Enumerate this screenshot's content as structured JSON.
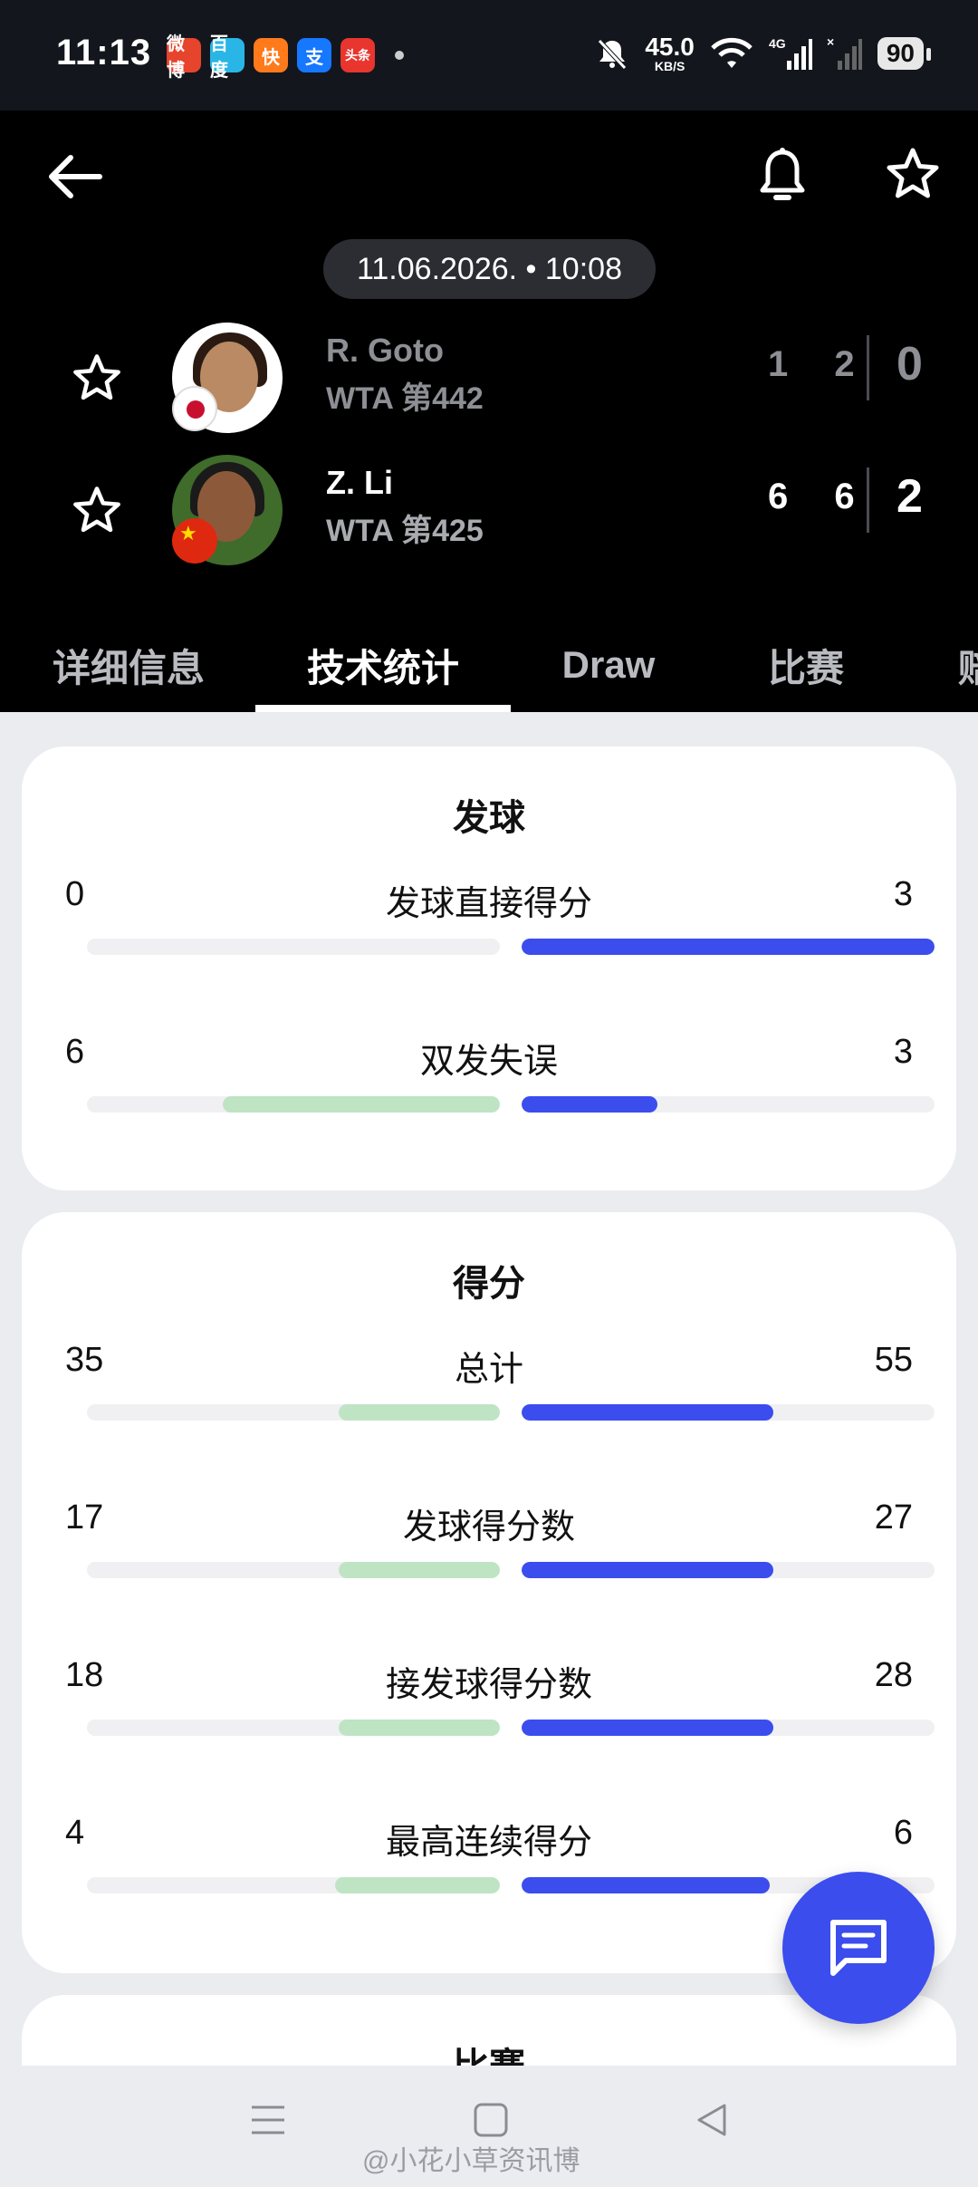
{
  "status_bar": {
    "time": "11:13",
    "net_speed": "45.0",
    "net_unit": "KB/S",
    "signal": "4G",
    "battery": "90",
    "apps": [
      "微博",
      "百度",
      "快",
      "支",
      "头条"
    ]
  },
  "header": {
    "datetime": "11.06.2026. • 10:08",
    "players": [
      {
        "name": "R. Goto",
        "rank": "WTA 第442",
        "sets": "1 2",
        "total": "0",
        "flag": "JP"
      },
      {
        "name": "Z. Li",
        "rank": "WTA 第425",
        "sets": "6 6",
        "total": "2",
        "flag": "CN"
      }
    ]
  },
  "tabs": [
    {
      "label": "详细信息",
      "active": false
    },
    {
      "label": "技术统计",
      "active": true
    },
    {
      "label": "Draw",
      "active": false
    },
    {
      "label": "比赛",
      "active": false
    },
    {
      "label": "赔",
      "active": false
    }
  ],
  "sections": [
    {
      "title": "发球",
      "stats": [
        {
          "label": "发球直接得分",
          "left": "0",
          "right": "3",
          "left_share": 0.0,
          "right_share": 1.0
        },
        {
          "label": "双发失误",
          "left": "6",
          "right": "3",
          "left_share": 0.67,
          "right_share": 0.33
        }
      ]
    },
    {
      "title": "得分",
      "stats": [
        {
          "label": "总计",
          "left": "35",
          "right": "55",
          "left_share": 0.39,
          "right_share": 0.61
        },
        {
          "label": "发球得分数",
          "left": "17",
          "right": "27",
          "left_share": 0.39,
          "right_share": 0.61
        },
        {
          "label": "接发球得分数",
          "left": "18",
          "right": "28",
          "left_share": 0.39,
          "right_share": 0.61
        },
        {
          "label": "最高连续得分",
          "left": "4",
          "right": "6",
          "left_share": 0.4,
          "right_share": 0.6
        }
      ]
    },
    {
      "title": "比赛",
      "stats": []
    }
  ],
  "watermark": "@小花小草资讯博",
  "colors": {
    "accent": "#3b4ded",
    "left_bar": "#bfe4c4",
    "header_bg": "#000000",
    "content_bg": "#eaecf0"
  }
}
